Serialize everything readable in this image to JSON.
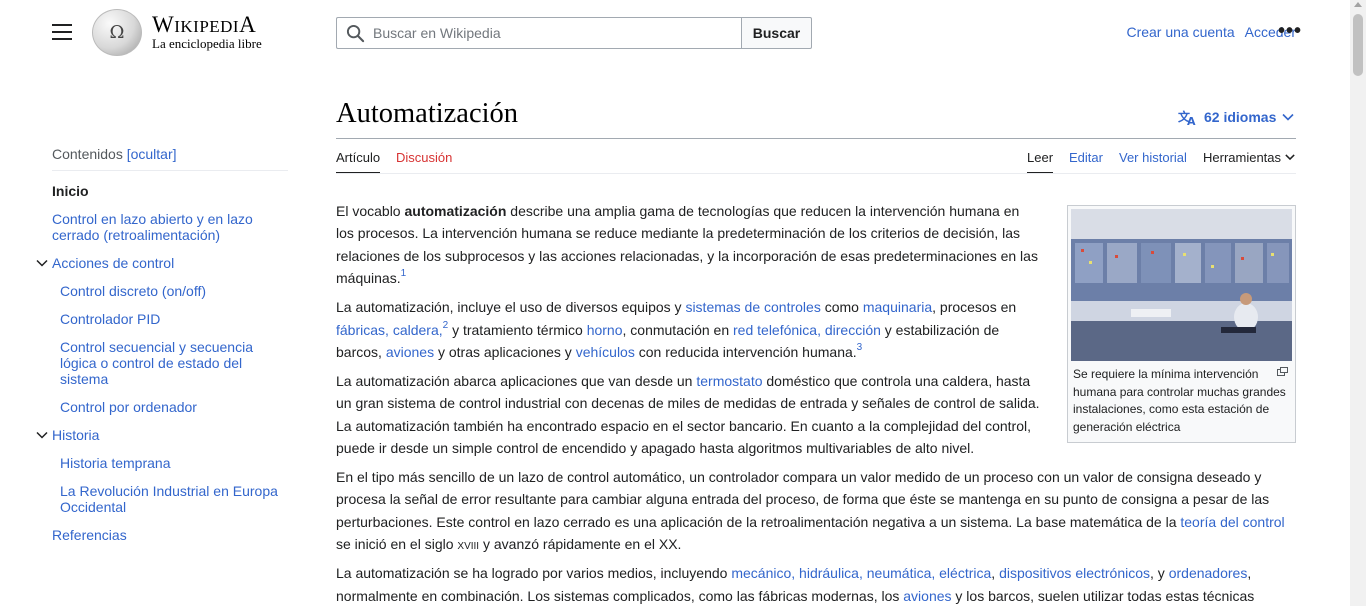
{
  "header": {
    "wordmark_title": "Wikipedia",
    "wordmark_tagline": "La enciclopedia libre",
    "globe_glyph": "Ω",
    "search_placeholder": "Buscar en Wikipedia",
    "search_button": "Buscar",
    "create_account": "Crear una cuenta",
    "login": "Acceder",
    "more_menu": "•••"
  },
  "toc": {
    "title": "Contenidos",
    "toggle": "[ocultar]",
    "items": [
      {
        "label": "Inicio"
      },
      {
        "label": "Control en lazo abierto y en lazo cerrado (retroalimentación)"
      },
      {
        "label": "Acciones de control"
      },
      {
        "label": "Control discreto (on/off)"
      },
      {
        "label": "Controlador PID"
      },
      {
        "label": "Control secuencial y secuencia lógica o control de estado del sistema"
      },
      {
        "label": "Control por ordenador"
      },
      {
        "label": "Historia"
      },
      {
        "label": "Historia temprana"
      },
      {
        "label": "La Revolución Industrial en Europa Occidental"
      },
      {
        "label": "Referencias"
      }
    ]
  },
  "article": {
    "title": "Automatización",
    "languages": "62 idiomas",
    "tabs": {
      "article": "Artículo",
      "talk": "Discusión",
      "read": "Leer",
      "edit": "Editar",
      "history": "Ver historial",
      "tools": "Herramientas"
    },
    "thumb_caption": "Se requiere la mínima intervención humana para controlar muchas grandes instalaciones, como esta estación de generación eléctrica",
    "p1": {
      "a": "El vocablo ",
      "b": "automatización",
      "c": " describe una amplia gama de tecnologías que reducen la intervención humana en los procesos. La intervención humana se reduce mediante la predeterminación de los criterios de decisión, las relaciones de los subprocesos y las acciones relacionadas, y la incorporación de esas predeterminaciones en las máquinas.",
      "ref": "1"
    },
    "p2": {
      "a": "La automatización, incluye el uso de diversos equipos y ",
      "l1": "sistemas de controles",
      "b": " como ",
      "l2": "maquinaria",
      "c": ", procesos en ",
      "l3": "fábricas",
      "d": ", ",
      "l4": "caldera",
      "e": ",",
      "ref1": "2",
      "f": " y tratamiento térmico ",
      "l5": "horno",
      "g": ", conmutación en ",
      "l6": "red telefónica",
      "h": ", ",
      "l7": "dirección",
      "i": " y estabilización de barcos, ",
      "l8": "aviones",
      "j": " y otras aplicaciones y ",
      "l9": "vehículos",
      "k": " con reducida intervención humana.",
      "ref2": "3"
    },
    "p3": {
      "a": "La automatización abarca aplicaciones que van desde un ",
      "l1": "termostato",
      "b": " doméstico que controla una caldera, hasta un gran sistema de control industrial con decenas de miles de medidas de entrada y señales de control de salida. La automatización también ha encontrado espacio en el sector bancario. En cuanto a la complejidad del control, puede ir desde un simple control de encendido y apagado hasta algoritmos multivariables de alto nivel."
    },
    "p4": {
      "a": "En el tipo más sencillo de un lazo de control automático, un controlador compara un valor medido de un proceso con un valor de consigna deseado y procesa la señal de error resultante para cambiar alguna entrada del proceso, de forma que éste se mantenga en su punto de consigna a pesar de las perturbaciones. Este control en lazo cerrado es una aplicación de la retroalimentación negativa a un sistema. La base matemática de la ",
      "l1": "teoría del control",
      "b": " se inició en el siglo ",
      "c": "xviii",
      "d": " y avanzó rápidamente en el XX."
    },
    "p5": {
      "a": "La automatización se ha logrado por varios medios, incluyendo ",
      "l1": "mecánico",
      "b": ", ",
      "l2": "hidráulica",
      "c": ", ",
      "l3": "neumática",
      "d": ", ",
      "l4": "eléctrica",
      "e": ", ",
      "l5": "dispositivos electrónicos",
      "f": ", y ",
      "l6": "ordenadores",
      "g": ", normalmente en combinación. Los sistemas complicados, como las fábricas modernas, los ",
      "l7": "aviones",
      "h": " y los barcos, suelen utilizar todas estas técnicas"
    }
  }
}
